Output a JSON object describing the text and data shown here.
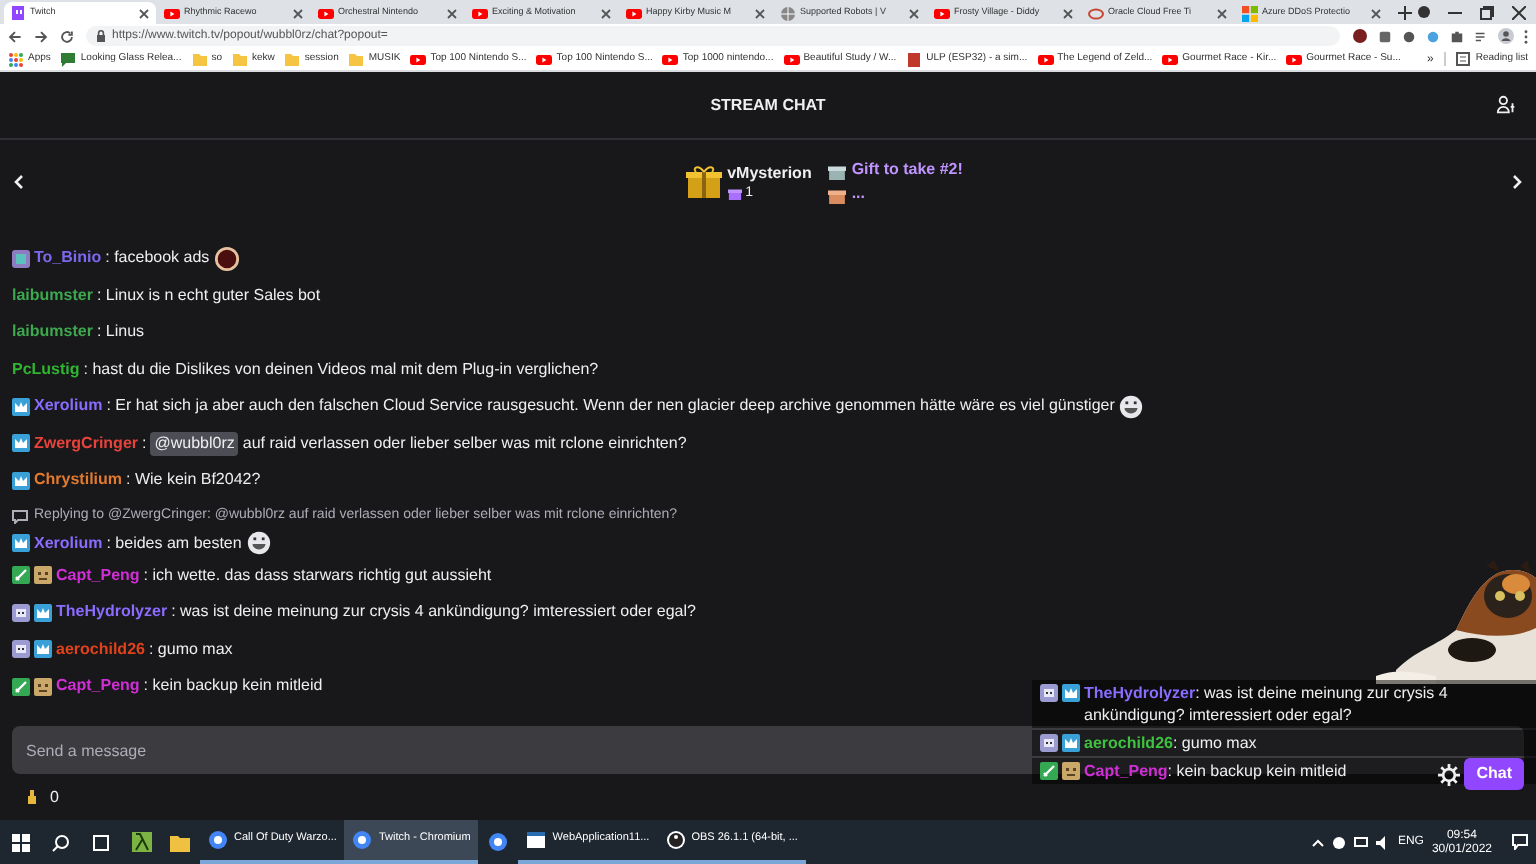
{
  "browser": {
    "tabs": [
      {
        "title": "Twitch",
        "kind": "twitch",
        "selected": true
      },
      {
        "title": "Rhythmic Racewo",
        "kind": "youtube",
        "selected": false
      },
      {
        "title": "Orchestral Nintendo",
        "kind": "youtube",
        "selected": false
      },
      {
        "title": "Exciting & Motivation",
        "kind": "youtube",
        "selected": false
      },
      {
        "title": "Happy Kirby Music M",
        "kind": "youtube",
        "selected": false
      },
      {
        "title": "Supported Robots | V",
        "kind": "globe",
        "selected": false
      },
      {
        "title": "Frosty Village - Diddy",
        "kind": "youtube",
        "selected": false
      },
      {
        "title": "Oracle Cloud Free Ti",
        "kind": "oracle",
        "selected": false
      },
      {
        "title": "Azure DDoS Protectio",
        "kind": "azure",
        "selected": false
      }
    ],
    "url": "https://www.twitch.tv/popout/wubbl0rz/chat?popout=",
    "bookmarks": [
      {
        "label": "Apps",
        "kind": "apps"
      },
      {
        "label": "Looking Glass Relea...",
        "kind": "page"
      },
      {
        "label": "so",
        "kind": "folder"
      },
      {
        "label": "kekw",
        "kind": "folder"
      },
      {
        "label": "session",
        "kind": "folder"
      },
      {
        "label": "MUSIK",
        "kind": "folder"
      },
      {
        "label": "Top 100 Nintendo S...",
        "kind": "youtube"
      },
      {
        "label": "Top 100 Nintendo S...",
        "kind": "youtube"
      },
      {
        "label": "Top 1000 nintendo...",
        "kind": "youtube"
      },
      {
        "label": "Beautiful Study / W...",
        "kind": "youtube"
      },
      {
        "label": "ULP (ESP32) - a sim...",
        "kind": "doc"
      },
      {
        "label": "The Legend of Zeld...",
        "kind": "youtube"
      },
      {
        "label": "Gourmet Race - Kir...",
        "kind": "youtube"
      },
      {
        "label": "Gourmet Race - Su...",
        "kind": "youtube"
      }
    ],
    "more": "»",
    "reading_list": "Reading list"
  },
  "header": {
    "title": "STREAM CHAT"
  },
  "gift_bar": {
    "leader": "vMysterion",
    "count": "1",
    "gift_title": "Gift to take #2!",
    "more": "..."
  },
  "messages": [
    {
      "badges": [
        {
          "kind": "sub"
        }
      ],
      "user": "To_Binio",
      "color": "#7b68ee",
      "text": ": facebook ads",
      "emote": {
        "kind": "cookie"
      }
    },
    {
      "user": "laibumster",
      "color": "#3ea84e",
      "text": ": Linux is n echt guter Sales bot"
    },
    {
      "user": "laibumster",
      "color": "#3ea84e",
      "text": ": Linus"
    },
    {
      "user": "PcLustig",
      "color": "#2fb52f",
      "text": ": hast du die Dislikes von deinen Videos mal mit dem Plug-in verglichen?"
    },
    {
      "badges": [
        {
          "kind": "crown"
        }
      ],
      "user": "Xerolium",
      "color": "#8a6cff",
      "text": ": Er hat sich ja aber auch den falschen Cloud Service rausgesucht. Wenn der nen glacier deep archive genommen hätte wäre es viel günstiger",
      "emote": {
        "kind": "face"
      }
    },
    {
      "badges": [
        {
          "kind": "crown"
        }
      ],
      "user": "ZwergCringer",
      "color": "#e8433b",
      "text": ":",
      "mention": "@wubbl0rz",
      "after": "auf raid verlassen oder lieber selber was mit rclone einrichten?"
    },
    {
      "badges": [
        {
          "kind": "crown"
        }
      ],
      "user": "Chrystilium",
      "color": "#e27a2e",
      "text": ": Wie kein Bf2042?"
    },
    {
      "reply": "Replying to @ZwergCringer: @wubbl0rz auf raid verlassen oder lieber selber was mit rclone einrichten?",
      "badges": [
        {
          "kind": "crown"
        }
      ],
      "user": "Xerolium",
      "color": "#8a6cff",
      "text": ": beides am besten",
      "emote": {
        "kind": "face"
      }
    },
    {
      "badges": [
        {
          "kind": "sword"
        },
        {
          "kind": "block"
        }
      ],
      "user": "Capt_Peng",
      "color": "#d12fd6",
      "text": ": ich wette. das dass starwars richtig gut aussieht"
    },
    {
      "badges": [
        {
          "kind": "robot"
        },
        {
          "kind": "crown"
        }
      ],
      "user": "TheHydrolyzer",
      "color": "#8a6cff",
      "text": ": was ist deine meinung zur crysis 4 ankündigung? imteressiert oder egal?"
    },
    {
      "badges": [
        {
          "kind": "robot"
        },
        {
          "kind": "crown"
        }
      ],
      "user": "aerochild26",
      "color": "#e0421b",
      "text": ": gumo max"
    },
    {
      "badges": [
        {
          "kind": "sword"
        },
        {
          "kind": "block"
        }
      ],
      "user": "Capt_Peng",
      "color": "#d12fd6",
      "text": ": kein backup kein mitleid"
    }
  ],
  "input": {
    "placeholder": "Send a message"
  },
  "points": "0",
  "chat_button": "Chat",
  "overlay": {
    "messages": [
      {
        "badges": [
          {
            "kind": "robot"
          },
          {
            "kind": "crown"
          }
        ],
        "user": "TheHydrolyzer",
        "color": "#8a6cff",
        "text": ": was ist deine meinung zur crysis 4 ankündigung? imteressiert oder egal?"
      },
      {
        "badges": [
          {
            "kind": "robot"
          },
          {
            "kind": "crown"
          }
        ],
        "user": "aerochild26",
        "color": "#3fc23f",
        "text": ": gumo max"
      },
      {
        "badges": [
          {
            "kind": "sword"
          },
          {
            "kind": "block"
          }
        ],
        "user": "Capt_Peng",
        "color": "#d12fd6",
        "text": ": kein backup kein mitleid"
      }
    ]
  },
  "taskbar": {
    "apps": [
      {
        "label": "Call Of Duty Warzo...",
        "kind": "chrome",
        "selected": false
      },
      {
        "label": "Twitch - Chromium",
        "kind": "chrome",
        "selected": true
      },
      {
        "label": "WebApplication11...",
        "kind": "window",
        "selected": false
      },
      {
        "label": "OBS 26.1.1 (64-bit, ...",
        "kind": "obs",
        "selected": false
      }
    ],
    "language": "ENG",
    "time": "09:54",
    "date": "30/01/2022"
  }
}
